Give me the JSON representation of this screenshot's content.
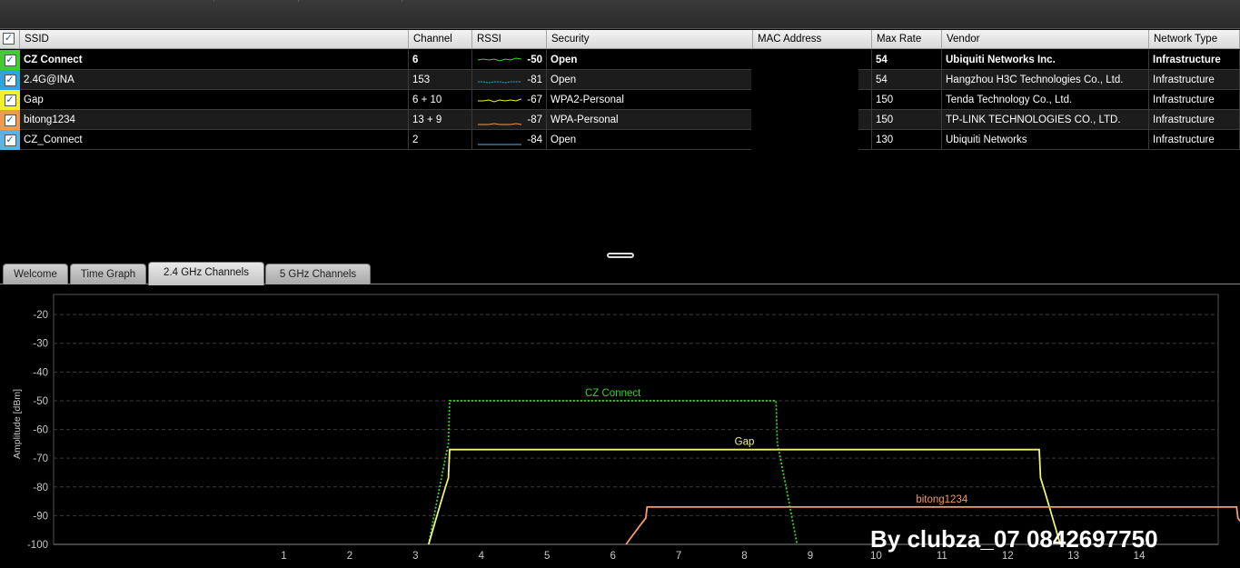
{
  "table": {
    "columns": [
      {
        "key": "ssid",
        "label": "SSID"
      },
      {
        "key": "channel",
        "label": "Channel"
      },
      {
        "key": "rssi",
        "label": "RSSI"
      },
      {
        "key": "security",
        "label": "Security"
      },
      {
        "key": "mac",
        "label": "MAC Address"
      },
      {
        "key": "max_rate",
        "label": "Max Rate"
      },
      {
        "key": "vendor",
        "label": "Vendor"
      },
      {
        "key": "network_type",
        "label": "Network Type"
      }
    ],
    "rows": [
      {
        "color": "#3ecf2e",
        "checked": true,
        "ssid": "CZ Connect",
        "channel": "6",
        "rssi": "-50",
        "security": "Open",
        "mac": "",
        "max_rate": "54",
        "vendor": "Ubiquiti Networks Inc.",
        "network_type": "Infrastructure",
        "bold": true
      },
      {
        "color": "#2aa7e0",
        "checked": true,
        "ssid": "2.4G@INA",
        "channel": "153",
        "rssi": "-81",
        "security": "Open",
        "mac": "",
        "max_rate": "54",
        "vendor": "Hangzhou H3C Technologies Co., Ltd.",
        "network_type": "Infrastructure",
        "bold": false
      },
      {
        "color": "#f2f02a",
        "checked": true,
        "ssid": "Gap",
        "channel": "6 + 10",
        "rssi": "-67",
        "security": "WPA2-Personal",
        "mac": "",
        "max_rate": "150",
        "vendor": "Tenda Technology Co., Ltd.",
        "network_type": "Infrastructure",
        "bold": false
      },
      {
        "color": "#f39a4a",
        "checked": true,
        "ssid": "bitong1234",
        "channel": "13 + 9",
        "rssi": "-87",
        "security": "WPA-Personal",
        "mac": "",
        "max_rate": "150",
        "vendor": "TP-LINK TECHNOLOGIES CO., LTD.",
        "network_type": "Infrastructure",
        "bold": false
      },
      {
        "color": "#59b4e6",
        "checked": true,
        "ssid": "CZ_Connect",
        "channel": "2",
        "rssi": "-84",
        "security": "Open",
        "mac": "",
        "max_rate": "130",
        "vendor": "Ubiquiti Networks",
        "network_type": "Infrastructure",
        "bold": false
      }
    ]
  },
  "tabs": [
    {
      "label": "Welcome",
      "active": false
    },
    {
      "label": "Time Graph",
      "active": false
    },
    {
      "label": "2.4 GHz Channels",
      "active": true
    },
    {
      "label": "5 GHz Channels",
      "active": false
    }
  ],
  "chart_data": {
    "type": "area",
    "ylabel": "Amplitude [dBm]",
    "xlabel": "",
    "ylim": [
      -100,
      -13
    ],
    "xlim": [
      -2.5,
      15.2
    ],
    "yticks": [
      -20,
      -30,
      -40,
      -50,
      -60,
      -70,
      -80,
      -90,
      -100
    ],
    "xticks": [
      1,
      2,
      3,
      4,
      5,
      6,
      7,
      8,
      9,
      10,
      11,
      12,
      13,
      14
    ],
    "grid": true,
    "series": [
      {
        "name": "CZ Connect",
        "color": "#3ecf2e",
        "dashed": true,
        "center_channel": 6,
        "width_channels": 5,
        "amplitude": -50
      },
      {
        "name": "Gap",
        "color": "#f2f27a",
        "dashed": false,
        "center_channel": 8,
        "width_channels": 9,
        "amplitude": -67
      },
      {
        "name": "bitong1234",
        "color": "#f39a6a",
        "dashed": false,
        "center_channel": 11,
        "width_channels": 9,
        "amplitude": -87
      }
    ]
  },
  "watermark": "By clubza_07  0842697750"
}
